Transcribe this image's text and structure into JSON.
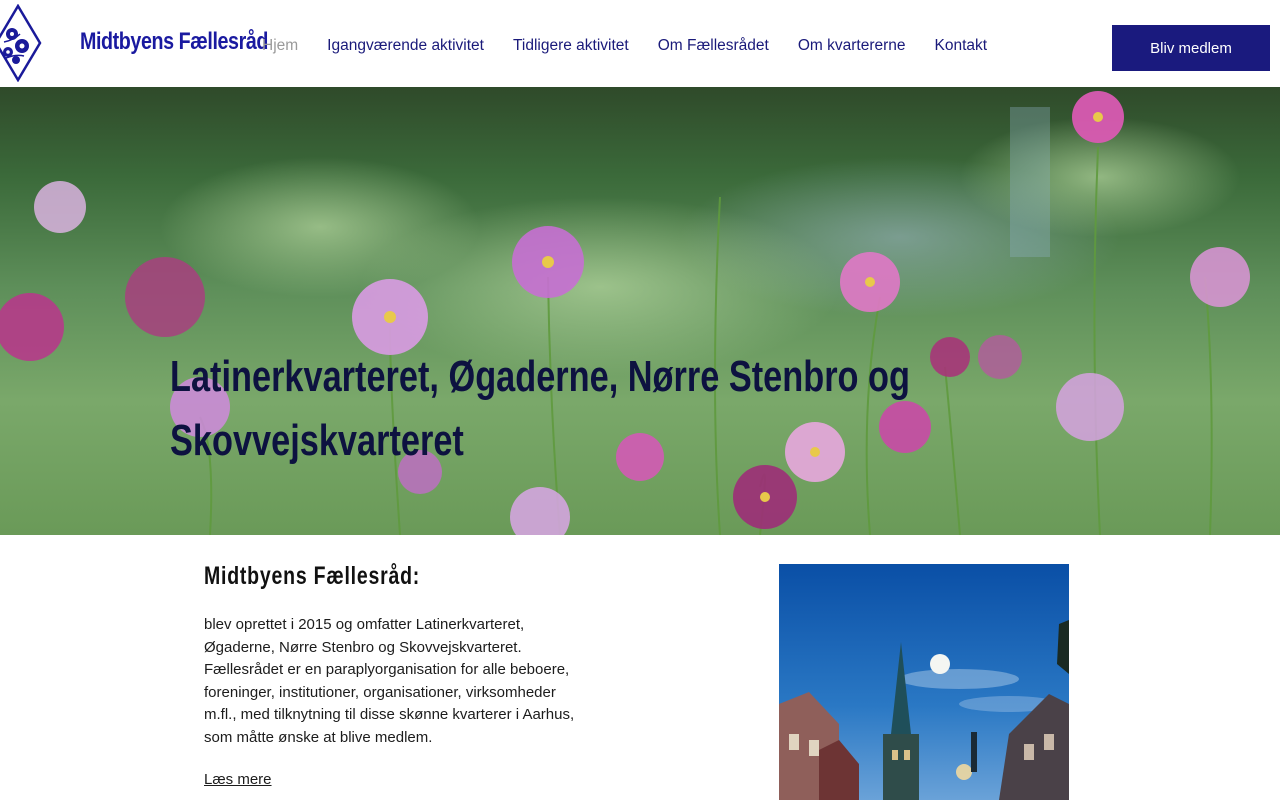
{
  "header": {
    "site_title": "Midtbyens Fællesråd",
    "logo_icon": "flower-emblem-icon",
    "nav": [
      {
        "label": "Hjem",
        "active": true
      },
      {
        "label": "Igangværende aktivitet",
        "active": false
      },
      {
        "label": "Tidligere aktivitet",
        "active": false
      },
      {
        "label": "Om Fællesrådet",
        "active": false
      },
      {
        "label": "Om kvartererne",
        "active": false
      },
      {
        "label": "Kontakt",
        "active": false
      }
    ],
    "cta_label": "Bliv medlem"
  },
  "hero": {
    "title_line1": "Latinerkvarteret, Øgaderne, Nørre Stenbro og",
    "title_line2": "Skovvejskvarteret",
    "background": "flower-field-image"
  },
  "content": {
    "heading": "Midtbyens Fællesråd:",
    "body": "blev oprettet i 2015 og omfatter Latinerkvarteret, Øgaderne, Nørre Stenbro og Skovvejskvarteret. Fællesrådet er en paraplyorganisation for alle beboere, foreninger, institutioner, organisationer, virksomheder m.fl., med tilknytning til disse skønne kvarterer i Aarhus, som måtte ønske at blive medlem.",
    "read_more": "Læs mere",
    "photo": "church-spire-moon-photo"
  },
  "colors": {
    "brand": "#1a1a7e",
    "nav_text": "#1a1a7a",
    "nav_active": "#9a9a9a",
    "hero_title": "#0d1240"
  }
}
